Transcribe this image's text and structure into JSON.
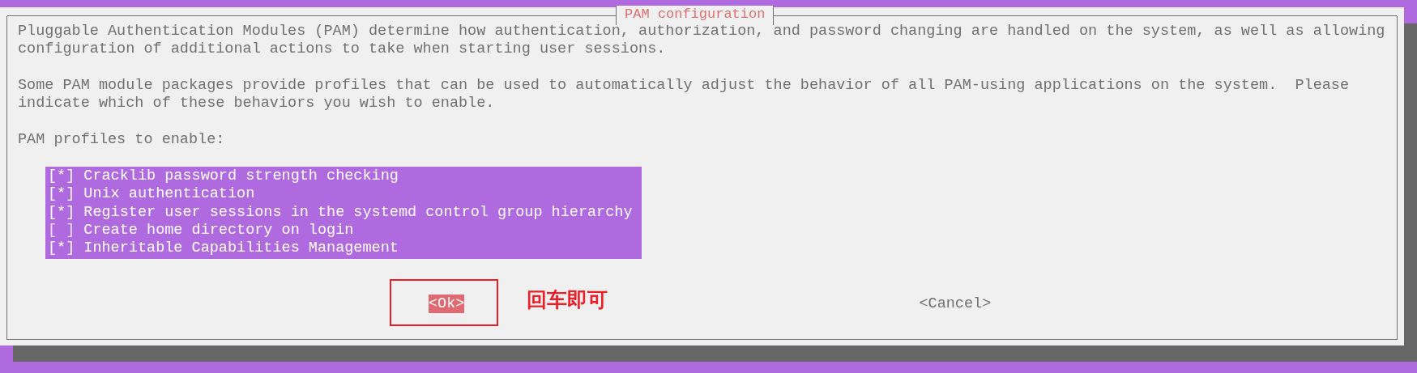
{
  "dialog": {
    "title": "PAM configuration",
    "paragraphs": [
      "Pluggable Authentication Modules (PAM) determine how authentication, authorization, and password changing are handled on the system, as well as allowing\nconfiguration of additional actions to take when starting user sessions.",
      "Some PAM module packages provide profiles that can be used to automatically adjust the behavior of all PAM-using applications on the system.  Please\nindicate which of these behaviors you wish to enable.",
      "PAM profiles to enable:"
    ],
    "profiles": [
      {
        "box": "[*]",
        "label": "Cracklib password strength checking",
        "checked": true
      },
      {
        "box": "[*]",
        "label": "Unix authentication",
        "checked": true
      },
      {
        "box": "[*]",
        "label": "Register user sessions in the systemd control group hierarchy",
        "checked": true
      },
      {
        "box": "[ ]",
        "label": "Create home directory on login",
        "checked": false
      },
      {
        "box": "[*]",
        "label": "Inheritable Capabilities Management",
        "checked": true
      }
    ],
    "buttons": [
      {
        "label": "<Ok>",
        "selected": true
      },
      {
        "label": "<Cancel>",
        "selected": false
      }
    ]
  },
  "annotation": {
    "text": "回车即可"
  }
}
